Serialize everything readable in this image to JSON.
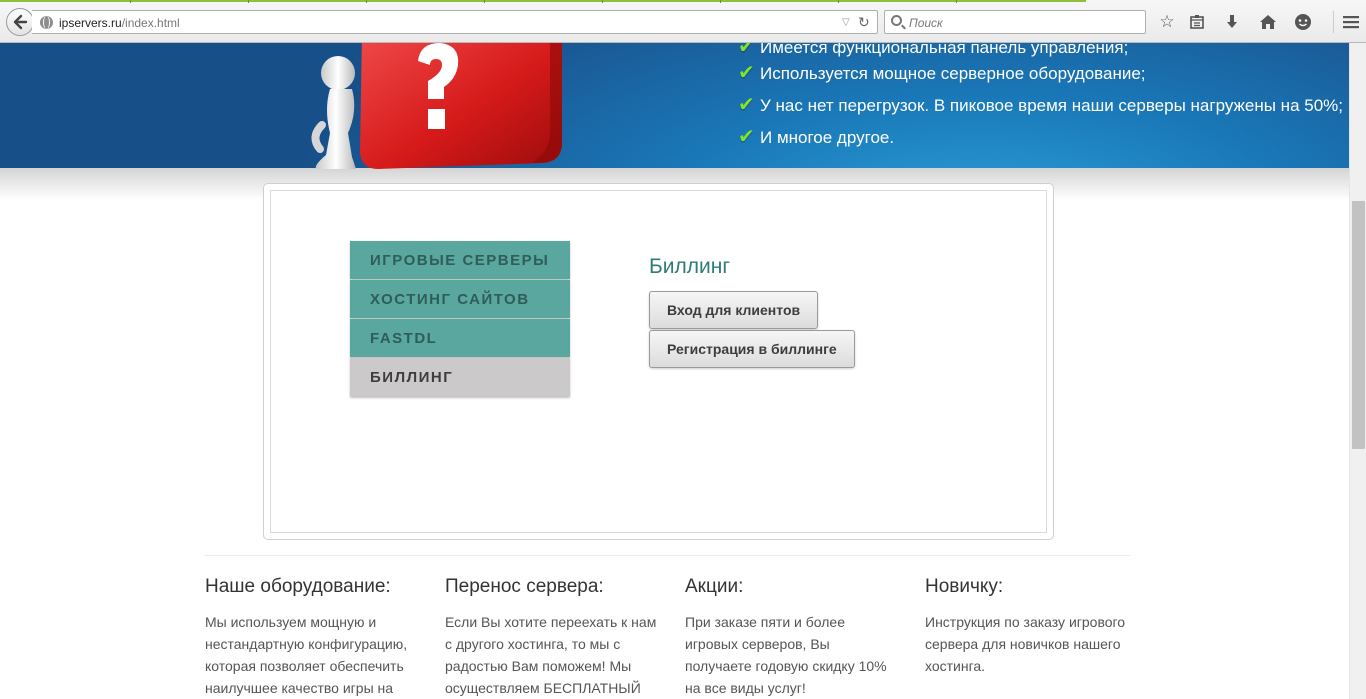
{
  "browser": {
    "url_domain": "ipservers.ru",
    "url_path": "/index.html",
    "search_placeholder": "Поиск"
  },
  "banner": {
    "features": [
      "Имеется функциональная панель управления;",
      "Используется мощное серверное оборудование;",
      "У нас нет перегрузок. В пиковое время наши серверы нагружены на 50%;",
      "И многое другое."
    ]
  },
  "tabs": [
    {
      "label": "ИГРОВЫЕ СЕРВЕРЫ",
      "active": false
    },
    {
      "label": "ХОСТИНГ САЙТОВ",
      "active": false
    },
    {
      "label": "FASTDL",
      "active": false
    },
    {
      "label": "БИЛЛИНГ",
      "active": true
    }
  ],
  "billing": {
    "title": "Биллинг",
    "login_button": "Вход для клиентов",
    "register_button": "Регистрация в биллинге"
  },
  "info_columns": [
    {
      "title": "Наше оборудование:",
      "text": "Мы используем мощную и нестандартную конфигурацию, которая позволяет обеспечить наилучшее качество игры на"
    },
    {
      "title": "Перенос сервера:",
      "text": "Если Вы хотите переехать к нам с другого хостинга, то мы с радостью Вам поможем! Мы осуществляем БЕСПЛАТНЫЙ"
    },
    {
      "title": "Акции:",
      "text": "При заказе пяти и более игровых серверов, Вы получаете годовую скидку 10% на все виды услуг!"
    },
    {
      "title": "Новичку:",
      "text": "Инструкция по заказу игрового сервера для новичков нашего хостинга."
    }
  ],
  "colors": {
    "tab_inactive": "#5aa7a0",
    "tab_active": "#cbc9c9",
    "accent_title": "#2f7b78",
    "check": "#7fe22e"
  }
}
